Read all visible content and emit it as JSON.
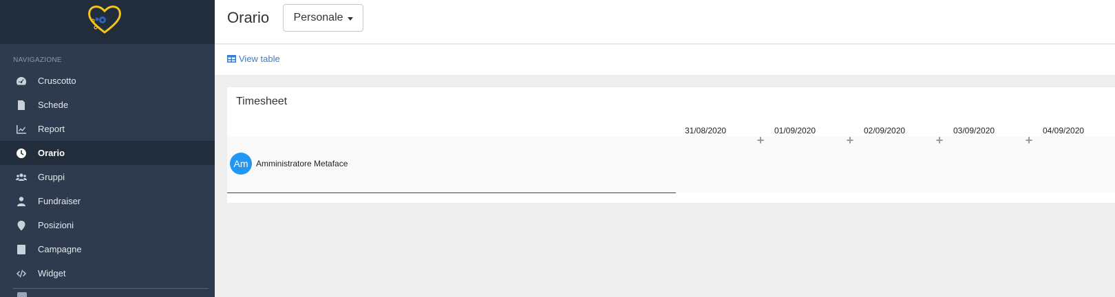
{
  "sidebar": {
    "section_header": "NAVIGAZIONE",
    "items": [
      {
        "label": "Cruscotto",
        "icon": "gauge-icon"
      },
      {
        "label": "Schede",
        "icon": "document-icon"
      },
      {
        "label": "Report",
        "icon": "chart-line-icon"
      },
      {
        "label": "Orario",
        "icon": "clock-icon",
        "active": true
      },
      {
        "label": "Gruppi",
        "icon": "users-icon"
      },
      {
        "label": "Fundraiser",
        "icon": "user-icon"
      },
      {
        "label": "Posizioni",
        "icon": "map-pin-icon"
      },
      {
        "label": "Campagne",
        "icon": "tablet-icon"
      },
      {
        "label": "Widget",
        "icon": "code-icon"
      }
    ]
  },
  "header": {
    "title": "Orario",
    "dropdown_value": "Personale"
  },
  "toolbar": {
    "view_table_label": "View table"
  },
  "timesheet": {
    "title": "Timesheet",
    "dates": [
      "31/08/2020",
      "01/09/2020",
      "02/09/2020",
      "03/09/2020",
      "04/09/2020"
    ],
    "rows": [
      {
        "avatar_initials": "Am",
        "name": "Amministratore Metaface"
      }
    ]
  },
  "colors": {
    "sidebar_bg": "#2e3b4e",
    "sidebar_dark": "#222d3b",
    "accent_link": "#3c7ec9",
    "avatar": "#2196f3",
    "logo_heart": "#f2c41d",
    "logo_gear": "#2a64c5"
  }
}
